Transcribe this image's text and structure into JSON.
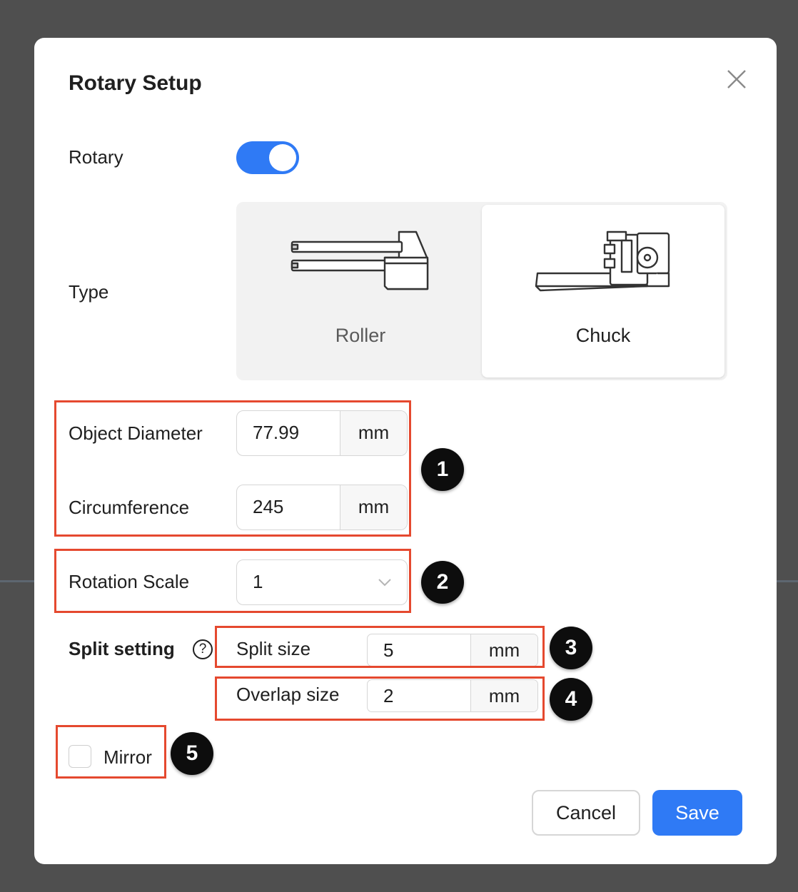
{
  "dialog": {
    "title": "Rotary Setup",
    "close_icon": "close-icon"
  },
  "rotary": {
    "label": "Rotary",
    "enabled": true,
    "accent_color": "#2f7af5"
  },
  "type": {
    "label": "Type",
    "options": [
      {
        "label": "Roller",
        "icon": "roller-icon",
        "selected": false
      },
      {
        "label": "Chuck",
        "icon": "chuck-icon",
        "selected": true
      }
    ]
  },
  "object_diameter": {
    "label": "Object Diameter",
    "value": "77.99",
    "unit": "mm"
  },
  "circumference": {
    "label": "Circumference",
    "value": "245",
    "unit": "mm"
  },
  "rotation_scale": {
    "label": "Rotation Scale",
    "value": "1"
  },
  "split_setting": {
    "label": "Split setting",
    "help": "?",
    "split_size": {
      "label": "Split size",
      "value": "5",
      "unit": "mm"
    },
    "overlap_size": {
      "label": "Overlap size",
      "value": "2",
      "unit": "mm"
    }
  },
  "mirror": {
    "label": "Mirror",
    "checked": false
  },
  "buttons": {
    "cancel": "Cancel",
    "save": "Save"
  },
  "annotations": {
    "color": "#e5492f",
    "badges": [
      "1",
      "2",
      "3",
      "4",
      "5"
    ]
  }
}
